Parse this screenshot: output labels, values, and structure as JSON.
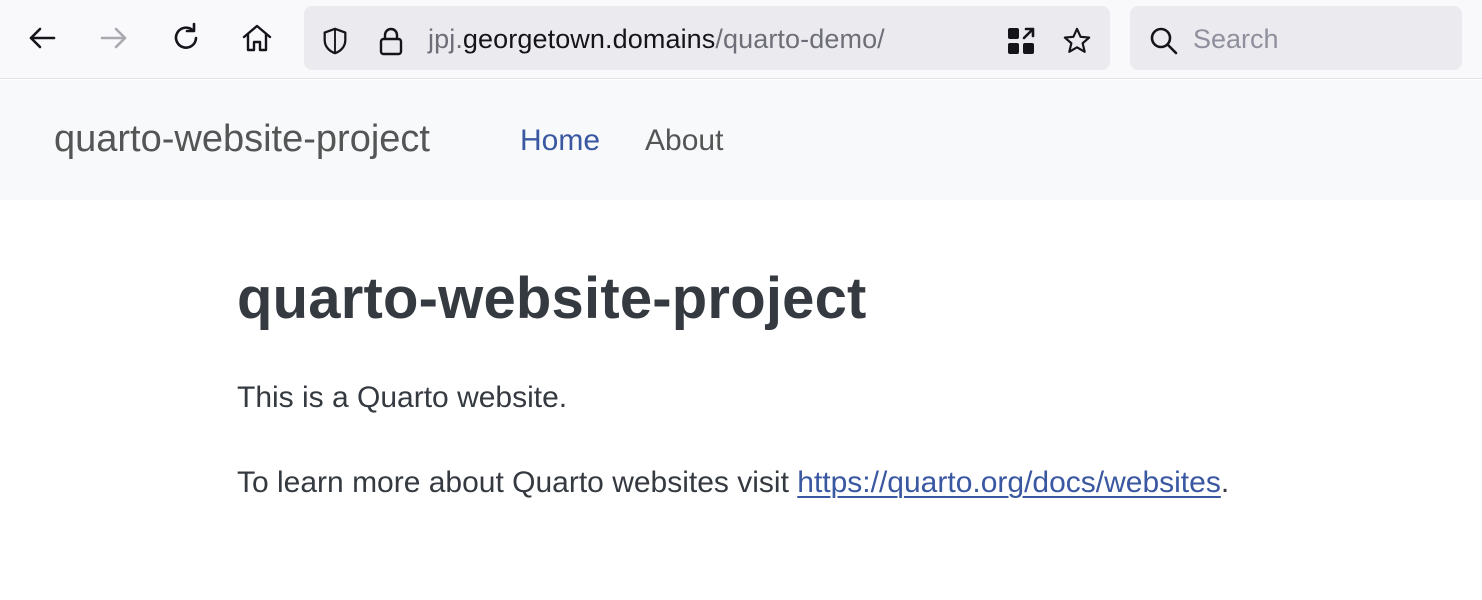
{
  "browser": {
    "url": {
      "prefix": "jpj.",
      "domain": "georgetown.domains",
      "path": "/quarto-demo/"
    },
    "search": {
      "placeholder": "Search"
    },
    "icons": {
      "back": "back-arrow-icon",
      "forward": "forward-arrow-icon",
      "reload": "reload-icon",
      "home": "home-icon",
      "tracking_protection": "shield-icon",
      "security": "lock-icon",
      "qr": "qr-code-icon",
      "bookmark": "star-icon",
      "search": "search-icon"
    }
  },
  "site": {
    "brand": "quarto-website-project",
    "nav": [
      {
        "label": "Home",
        "active": true
      },
      {
        "label": "About",
        "active": false
      }
    ]
  },
  "content": {
    "title": "quarto-website-project",
    "paragraph1": "This is a Quarto website.",
    "paragraph2_prefix": "To learn more about Quarto websites visit ",
    "link_text": "https://quarto.org/docs/websites",
    "paragraph2_suffix": "."
  },
  "colors": {
    "link": "#3a57a1",
    "text": "#343a40",
    "navbar_bg": "#f8f9fa",
    "toolbar_bg": "#f9f9fb",
    "urlbar_bg": "#ebebef"
  }
}
